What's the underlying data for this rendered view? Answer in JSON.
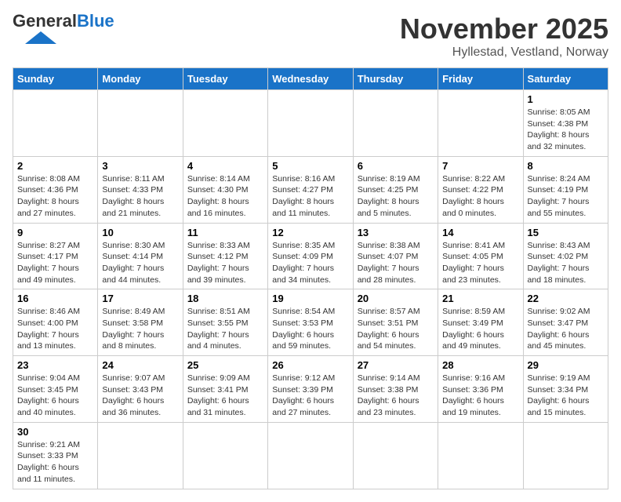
{
  "header": {
    "logo_general": "General",
    "logo_blue": "Blue",
    "month_title": "November 2025",
    "location": "Hyllestad, Vestland, Norway"
  },
  "weekdays": [
    "Sunday",
    "Monday",
    "Tuesday",
    "Wednesday",
    "Thursday",
    "Friday",
    "Saturday"
  ],
  "weeks": [
    [
      {
        "day": "",
        "info": ""
      },
      {
        "day": "",
        "info": ""
      },
      {
        "day": "",
        "info": ""
      },
      {
        "day": "",
        "info": ""
      },
      {
        "day": "",
        "info": ""
      },
      {
        "day": "",
        "info": ""
      },
      {
        "day": "1",
        "info": "Sunrise: 8:05 AM\nSunset: 4:38 PM\nDaylight: 8 hours and 32 minutes."
      }
    ],
    [
      {
        "day": "2",
        "info": "Sunrise: 8:08 AM\nSunset: 4:36 PM\nDaylight: 8 hours and 27 minutes."
      },
      {
        "day": "3",
        "info": "Sunrise: 8:11 AM\nSunset: 4:33 PM\nDaylight: 8 hours and 21 minutes."
      },
      {
        "day": "4",
        "info": "Sunrise: 8:14 AM\nSunset: 4:30 PM\nDaylight: 8 hours and 16 minutes."
      },
      {
        "day": "5",
        "info": "Sunrise: 8:16 AM\nSunset: 4:27 PM\nDaylight: 8 hours and 11 minutes."
      },
      {
        "day": "6",
        "info": "Sunrise: 8:19 AM\nSunset: 4:25 PM\nDaylight: 8 hours and 5 minutes."
      },
      {
        "day": "7",
        "info": "Sunrise: 8:22 AM\nSunset: 4:22 PM\nDaylight: 8 hours and 0 minutes."
      },
      {
        "day": "8",
        "info": "Sunrise: 8:24 AM\nSunset: 4:19 PM\nDaylight: 7 hours and 55 minutes."
      }
    ],
    [
      {
        "day": "9",
        "info": "Sunrise: 8:27 AM\nSunset: 4:17 PM\nDaylight: 7 hours and 49 minutes."
      },
      {
        "day": "10",
        "info": "Sunrise: 8:30 AM\nSunset: 4:14 PM\nDaylight: 7 hours and 44 minutes."
      },
      {
        "day": "11",
        "info": "Sunrise: 8:33 AM\nSunset: 4:12 PM\nDaylight: 7 hours and 39 minutes."
      },
      {
        "day": "12",
        "info": "Sunrise: 8:35 AM\nSunset: 4:09 PM\nDaylight: 7 hours and 34 minutes."
      },
      {
        "day": "13",
        "info": "Sunrise: 8:38 AM\nSunset: 4:07 PM\nDaylight: 7 hours and 28 minutes."
      },
      {
        "day": "14",
        "info": "Sunrise: 8:41 AM\nSunset: 4:05 PM\nDaylight: 7 hours and 23 minutes."
      },
      {
        "day": "15",
        "info": "Sunrise: 8:43 AM\nSunset: 4:02 PM\nDaylight: 7 hours and 18 minutes."
      }
    ],
    [
      {
        "day": "16",
        "info": "Sunrise: 8:46 AM\nSunset: 4:00 PM\nDaylight: 7 hours and 13 minutes."
      },
      {
        "day": "17",
        "info": "Sunrise: 8:49 AM\nSunset: 3:58 PM\nDaylight: 7 hours and 8 minutes."
      },
      {
        "day": "18",
        "info": "Sunrise: 8:51 AM\nSunset: 3:55 PM\nDaylight: 7 hours and 4 minutes."
      },
      {
        "day": "19",
        "info": "Sunrise: 8:54 AM\nSunset: 3:53 PM\nDaylight: 6 hours and 59 minutes."
      },
      {
        "day": "20",
        "info": "Sunrise: 8:57 AM\nSunset: 3:51 PM\nDaylight: 6 hours and 54 minutes."
      },
      {
        "day": "21",
        "info": "Sunrise: 8:59 AM\nSunset: 3:49 PM\nDaylight: 6 hours and 49 minutes."
      },
      {
        "day": "22",
        "info": "Sunrise: 9:02 AM\nSunset: 3:47 PM\nDaylight: 6 hours and 45 minutes."
      }
    ],
    [
      {
        "day": "23",
        "info": "Sunrise: 9:04 AM\nSunset: 3:45 PM\nDaylight: 6 hours and 40 minutes."
      },
      {
        "day": "24",
        "info": "Sunrise: 9:07 AM\nSunset: 3:43 PM\nDaylight: 6 hours and 36 minutes."
      },
      {
        "day": "25",
        "info": "Sunrise: 9:09 AM\nSunset: 3:41 PM\nDaylight: 6 hours and 31 minutes."
      },
      {
        "day": "26",
        "info": "Sunrise: 9:12 AM\nSunset: 3:39 PM\nDaylight: 6 hours and 27 minutes."
      },
      {
        "day": "27",
        "info": "Sunrise: 9:14 AM\nSunset: 3:38 PM\nDaylight: 6 hours and 23 minutes."
      },
      {
        "day": "28",
        "info": "Sunrise: 9:16 AM\nSunset: 3:36 PM\nDaylight: 6 hours and 19 minutes."
      },
      {
        "day": "29",
        "info": "Sunrise: 9:19 AM\nSunset: 3:34 PM\nDaylight: 6 hours and 15 minutes."
      }
    ],
    [
      {
        "day": "30",
        "info": "Sunrise: 9:21 AM\nSunset: 3:33 PM\nDaylight: 6 hours and 11 minutes."
      },
      {
        "day": "",
        "info": ""
      },
      {
        "day": "",
        "info": ""
      },
      {
        "day": "",
        "info": ""
      },
      {
        "day": "",
        "info": ""
      },
      {
        "day": "",
        "info": ""
      },
      {
        "day": "",
        "info": ""
      }
    ]
  ]
}
